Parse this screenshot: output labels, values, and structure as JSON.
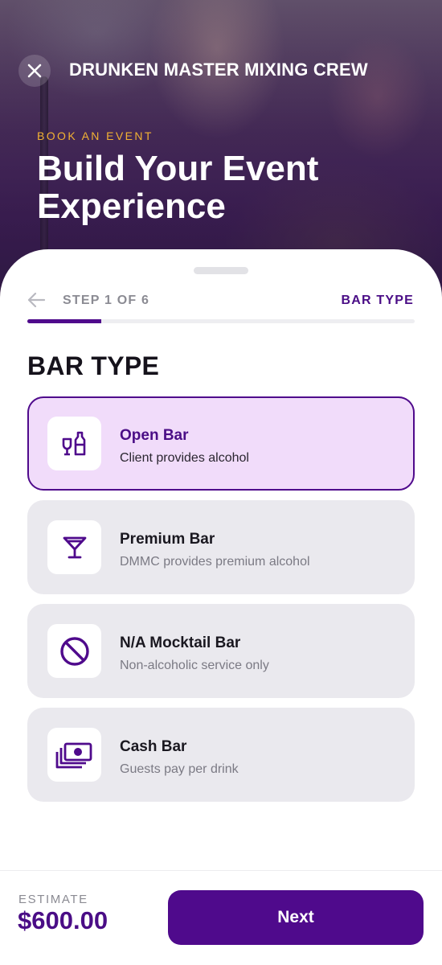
{
  "header": {
    "brand": "DRUNKEN MASTER MIXING CREW",
    "eyebrow": "BOOK AN EVENT",
    "headline": "Build Your Event Experience",
    "close_icon": "close-icon"
  },
  "stepper": {
    "back_icon": "arrow-left-icon",
    "step_label": "STEP 1 OF 6",
    "step_name": "BAR TYPE",
    "progress": 0.19
  },
  "section": {
    "title": "BAR TYPE"
  },
  "options": [
    {
      "title": "Open Bar",
      "description": "Client provides alcohol",
      "icon": "bottle-glass-icon",
      "selected": true
    },
    {
      "title": "Premium Bar",
      "description": "DMMC provides premium alcohol",
      "icon": "martini-icon",
      "selected": false
    },
    {
      "title": "N/A Mocktail Bar",
      "description": "Non-alcoholic service only",
      "icon": "prohibited-icon",
      "selected": false
    },
    {
      "title": "Cash Bar",
      "description": "Guests pay per drink",
      "icon": "cash-icon",
      "selected": false
    }
  ],
  "footer": {
    "estimate_label": "ESTIMATE",
    "estimate_value": "$600.00",
    "next_label": "Next"
  },
  "colors": {
    "accent": "#4f0a8c",
    "eyebrow": "#f2b233",
    "selected_bg": "#f1dcfa",
    "option_bg": "#eae9ee"
  }
}
